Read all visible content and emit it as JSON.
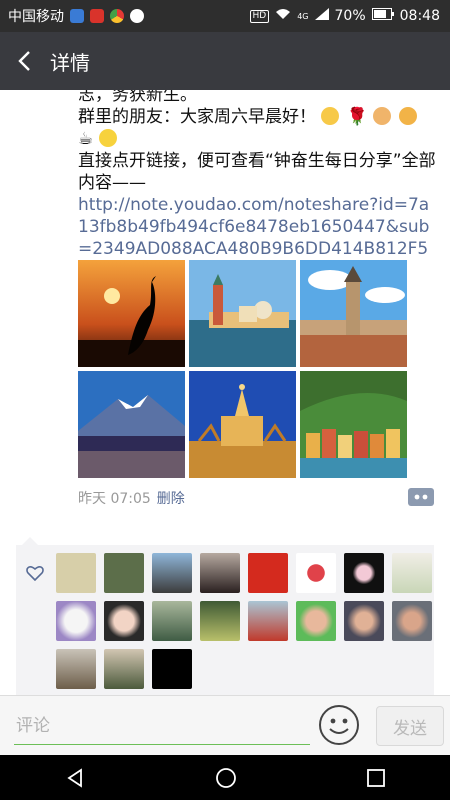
{
  "status_bar": {
    "carrier": "中国移动",
    "battery": "70%",
    "time": "08:48",
    "hd": "HD",
    "network": "4G"
  },
  "nav": {
    "title": "详情",
    "back_icon": "back-arrow-icon"
  },
  "post": {
    "line1": "志，务获新生。",
    "line2_prefix": "   群里的朋友：大家周六早晨好！",
    "line3_prefix": "   直接点开链接，便可查看“钟奋生每日分享”全部内容——",
    "link": "http://note.youdao.com/noteshare?id=7a13fb8b49fb494cf6e8478eb1650447&sub=2349AD088ACA480B9B6DD414B812F5",
    "time": "昨天 07:05",
    "delete_label": "删除"
  },
  "bottom_bar": {
    "comment_placeholder": "评论",
    "send_label": "发送"
  },
  "colors": {
    "nav_bg": "#393a3f",
    "link": "#576b95",
    "input_underline": "#6cbf57"
  }
}
